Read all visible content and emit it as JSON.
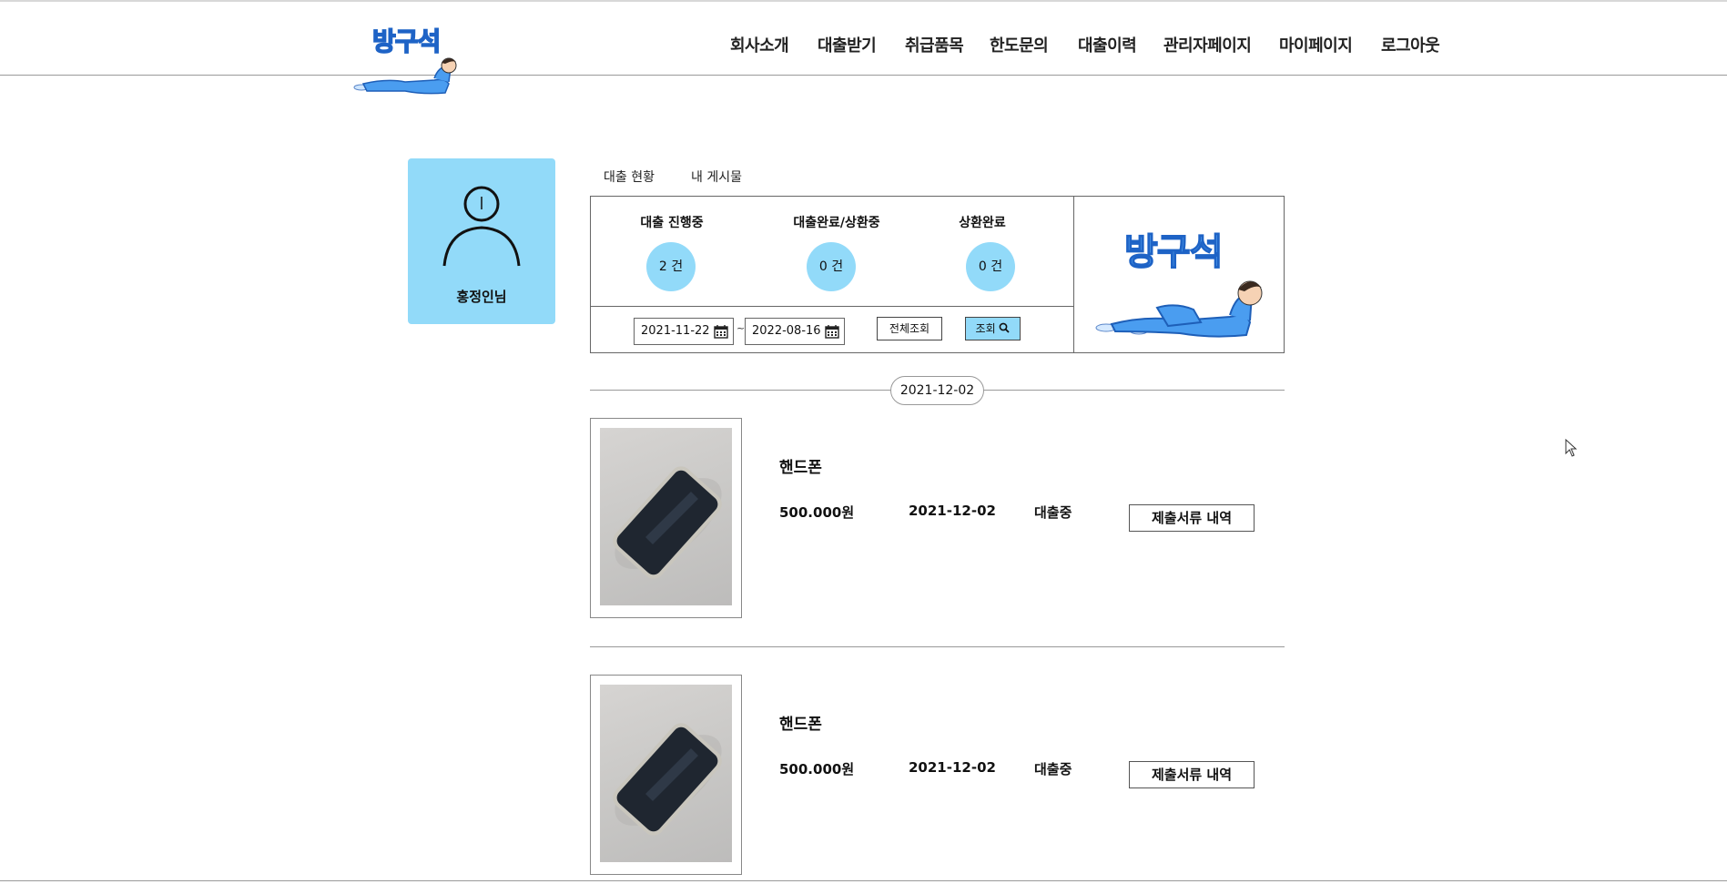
{
  "header": {
    "logo_text": "방구석",
    "nav": [
      "회사소개",
      "대출받기",
      "취급품목",
      "한도문의",
      "대출이력",
      "관리자페이지",
      "마이페이지",
      "로그아웃"
    ]
  },
  "profile": {
    "name": "홍정인님",
    "icon": "user-icon"
  },
  "tabs": [
    "대출 현황",
    "내 게시물"
  ],
  "status": {
    "items": [
      {
        "label": "대출 진행중",
        "count": "2 건"
      },
      {
        "label": "대출완료/상환중",
        "count": "0 건"
      },
      {
        "label": "상환완료",
        "count": "0 건"
      }
    ],
    "date_from": "2021-11-22",
    "date_to": "2022-08-16",
    "separator": "~",
    "all_button": "전체조회",
    "search_button": "조회"
  },
  "side_logo_text": "방구석",
  "group_date": "2021-12-02",
  "loans": [
    {
      "name": "핸드폰",
      "price": "500.000원",
      "date": "2021-12-02",
      "status": "대출중",
      "button": "제출서류 내역"
    },
    {
      "name": "핸드폰",
      "price": "500.000원",
      "date": "2021-12-02",
      "status": "대출중",
      "button": "제출서류 내역"
    }
  ],
  "colors": {
    "accent": "#92daf9",
    "logo_blue": "#5aa9f5"
  }
}
